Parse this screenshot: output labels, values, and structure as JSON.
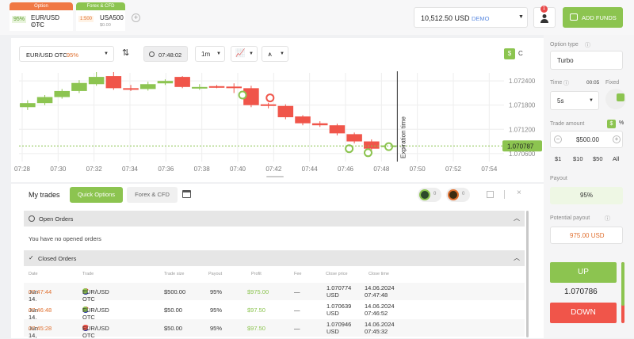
{
  "tabs": [
    {
      "header": "Option",
      "pct": "95%",
      "symbol": "EUR/USD OTC",
      "amount": "$0.00",
      "color": "#f07844"
    },
    {
      "header": "Forex & CFD",
      "pct": "1:500",
      "symbol": "USA500",
      "amount": "$0.00",
      "color": "#8cc450"
    }
  ],
  "balance": {
    "value": "10,512.50 USD",
    "mode": "DEMO"
  },
  "notif_count": "1",
  "add_funds": "ADD FUNDS",
  "toolbar": {
    "asset": "EUR/USD OTC",
    "asset_pct": "95%",
    "time": "07:48:02",
    "timeframe": "1m",
    "currency_btn": "$",
    "c_btn": "C"
  },
  "chart_data": {
    "type": "candlestick",
    "x": [
      "07:28",
      "07:30",
      "07:32",
      "07:34",
      "07:36",
      "07:38",
      "07:40",
      "07:42",
      "07:44",
      "07:46",
      "07:48",
      "07:50",
      "07:52",
      "07:54"
    ],
    "y_ticks": [
      "1.072400",
      "1.071800",
      "1.071200",
      "1.070600"
    ],
    "current_price": "1.070787",
    "expiration_label": "Expiration time",
    "candles": [
      {
        "o": 1.07175,
        "c": 1.07185,
        "h": 1.07192,
        "l": 1.07168
      },
      {
        "o": 1.07185,
        "c": 1.072,
        "h": 1.07205,
        "l": 1.0718
      },
      {
        "o": 1.072,
        "c": 1.07215,
        "h": 1.0722,
        "l": 1.07196
      },
      {
        "o": 1.07215,
        "c": 1.07235,
        "h": 1.07242,
        "l": 1.0721
      },
      {
        "o": 1.07232,
        "c": 1.0725,
        "h": 1.07262,
        "l": 1.07228
      },
      {
        "o": 1.07252,
        "c": 1.07222,
        "h": 1.07262,
        "l": 1.07218
      },
      {
        "o": 1.07222,
        "c": 1.0722,
        "h": 1.0723,
        "l": 1.07215
      },
      {
        "o": 1.0722,
        "c": 1.07232,
        "h": 1.07238,
        "l": 1.07216
      },
      {
        "o": 1.07234,
        "c": 1.0724,
        "h": 1.07244,
        "l": 1.0723
      },
      {
        "o": 1.0725,
        "c": 1.07225,
        "h": 1.07252,
        "l": 1.07222
      },
      {
        "o": 1.07225,
        "c": 1.07225,
        "h": 1.07232,
        "l": 1.07218
      },
      {
        "o": 1.07227,
        "c": 1.07226,
        "h": 1.0723,
        "l": 1.07222
      },
      {
        "o": 1.07226,
        "c": 1.07225,
        "h": 1.07234,
        "l": 1.0721
      },
      {
        "o": 1.07222,
        "c": 1.0718,
        "h": 1.07228,
        "l": 1.07175
      },
      {
        "o": 1.07182,
        "c": 1.07178,
        "h": 1.07186,
        "l": 1.07172
      },
      {
        "o": 1.07178,
        "c": 1.0715,
        "h": 1.07182,
        "l": 1.07145
      },
      {
        "o": 1.07152,
        "c": 1.07135,
        "h": 1.07155,
        "l": 1.0713
      },
      {
        "o": 1.07135,
        "c": 1.0713,
        "h": 1.0714,
        "l": 1.07126
      },
      {
        "o": 1.0713,
        "c": 1.0711,
        "h": 1.07134,
        "l": 1.07105
      },
      {
        "o": 1.07108,
        "c": 1.0709,
        "h": 1.07112,
        "l": 1.07085
      },
      {
        "o": 1.0709,
        "c": 1.07072,
        "h": 1.07095,
        "l": 1.07068
      },
      {
        "o": 1.07077,
        "c": 1.0708,
        "h": 1.07083,
        "l": 1.07074
      }
    ],
    "ylim": [
      1.0704,
      1.0726
    ]
  },
  "panel": {
    "option_type_label": "Option type",
    "option_type": "Turbo",
    "time_label": "Time",
    "time_value": "00:05",
    "fixed_label": "Fixed",
    "duration": "5s",
    "trade_amount_label": "Trade amount",
    "amount": "$500.00",
    "quick": [
      "$1",
      "$10",
      "$50",
      "All"
    ],
    "payout_label": "Payout",
    "payout": "95%",
    "potential_label": "Potential payout",
    "potential": "975.00 USD",
    "up": "UP",
    "price": "1.070786",
    "down": "DOWN"
  },
  "trades": {
    "title": "My trades",
    "tab_quick": "Quick Options",
    "tab_forex": "Forex & CFD",
    "badge1": "0",
    "badge2": "0",
    "open_title": "Open Orders",
    "open_empty": "You have no opened orders",
    "closed_title": "Closed Orders",
    "columns": [
      "Date",
      "Trade",
      "Trade size",
      "Payout",
      "Profit",
      "Fee",
      "Close price",
      "Close time"
    ],
    "rows": [
      {
        "date": "Jun 14,",
        "time": "07:47:44",
        "asset": "EUR/USD OTC",
        "size": "$500.00",
        "payout": "95%",
        "profit": "$975.00",
        "fee": "—",
        "price": "1.070774",
        "price_unit": "USD",
        "close_date": "14.06.2024",
        "close_time": "07:47:48",
        "win": true
      },
      {
        "date": "Jun 14,",
        "time": "07:46:48",
        "asset": "EUR/USD OTC",
        "size": "$50.00",
        "payout": "95%",
        "profit": "$97.50",
        "fee": "—",
        "price": "1.070639",
        "price_unit": "USD",
        "close_date": "14.06.2024",
        "close_time": "07:46:52",
        "win": true
      },
      {
        "date": "Jun 14,",
        "time": "07:45:28",
        "asset": "EUR/USD OTC",
        "size": "$50.00",
        "payout": "95%",
        "profit": "$97.50",
        "fee": "—",
        "price": "1.070946",
        "price_unit": "USD",
        "close_date": "14.06.2024",
        "close_time": "07:45:32",
        "win": false
      }
    ]
  }
}
